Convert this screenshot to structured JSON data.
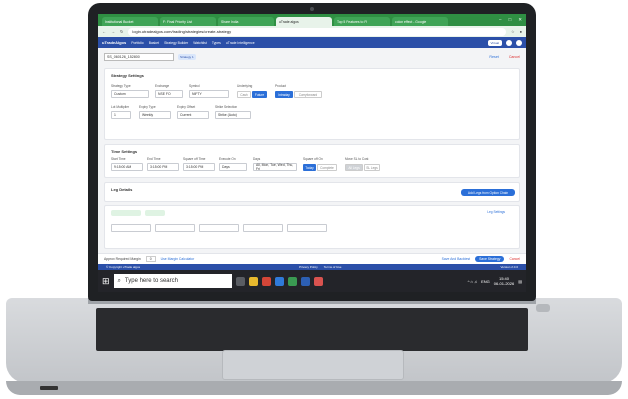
{
  "browser": {
    "tabs": [
      {
        "label": "Institutional Bucket"
      },
      {
        "label": "F: Final Priority List"
      },
      {
        "label": "Share India"
      },
      {
        "label": "uTrade algos",
        "active": true
      },
      {
        "label": "Top 5 Features to Fi"
      },
      {
        "label": "colon effect - Google"
      }
    ],
    "url": "login.utradealgos.com/trading/strategies/create-strategy"
  },
  "appnav": {
    "logo": "uTradeAlgos",
    "items": [
      "Portfolio",
      "Basket",
      "Strategy Builder",
      "Watchlist",
      "Types",
      "uTrade Intelligence"
    ],
    "right_pill": "Virtual",
    "brand_color": "#2b4fa8"
  },
  "strategy": {
    "name": "SS_060126_152800",
    "tag": "Strategy 1",
    "reset": "Reset",
    "cancel": "Cancel"
  },
  "settings": {
    "title": "Strategy Settings",
    "strategy_type_label": "Strategy Type",
    "strategy_type": "Custom",
    "exchange_label": "Exchange",
    "exchange": "NSE FO",
    "symbol_label": "Symbol",
    "symbol": "NIFTY",
    "underlying_label": "Underlying",
    "underlying_opts": [
      "Cash",
      "Future"
    ],
    "product_label": "Product",
    "product_opts": [
      "Intraday",
      "Carryforward"
    ],
    "lot_multiplier_label": "Lot Multiplier",
    "lot_multiplier": "1",
    "expiry_type_label": "Expiry Type",
    "expiry_type": "Weekly",
    "expiry_offset_label": "Expiry Offset",
    "expiry_offset": "Current",
    "strike_selection_label": "Strike Selection",
    "strike_selection": "Strike (Auto)"
  },
  "time": {
    "title": "Time Settings",
    "start_label": "Start Time",
    "start": "9:15:00 AM",
    "end_label": "End Time",
    "end": "3:15:00 PM",
    "sqoff_label": "Square off Time",
    "sqoff": "3:15:00 PM",
    "execute_label": "Execute On",
    "execute": "Days",
    "days_label": "Days",
    "days": "All, Mon, Tue, Wed, Thu, Fri",
    "sqoff_on_label": "Square off On",
    "sqoff_on_opts": [
      "Today",
      "Complete"
    ],
    "move_sl": "Move SL to Cost",
    "sl_opts": [
      "All Legs",
      "SL Legs"
    ]
  },
  "legs": {
    "title": "Leg Details",
    "add_legs": "Add Legs from Option Chain",
    "leg_settings": "Leg Settings"
  },
  "bottom": {
    "margin_label": "Approx Required Margin",
    "margin_value": "0",
    "margin_calc": "Use Margin Calculator",
    "save_backtest": "Save And Backtest",
    "save": "Save Strategy",
    "cancel": "Cancel"
  },
  "footer": {
    "copyright": "© Copyright uTrade algos",
    "privacy": "Privacy Policy",
    "terms": "Terms of Use",
    "version": "Version 2.0.0"
  },
  "taskbar": {
    "search": "Type here to search",
    "lang": "ENG",
    "time": "15:40",
    "date": "06-01-2026"
  }
}
